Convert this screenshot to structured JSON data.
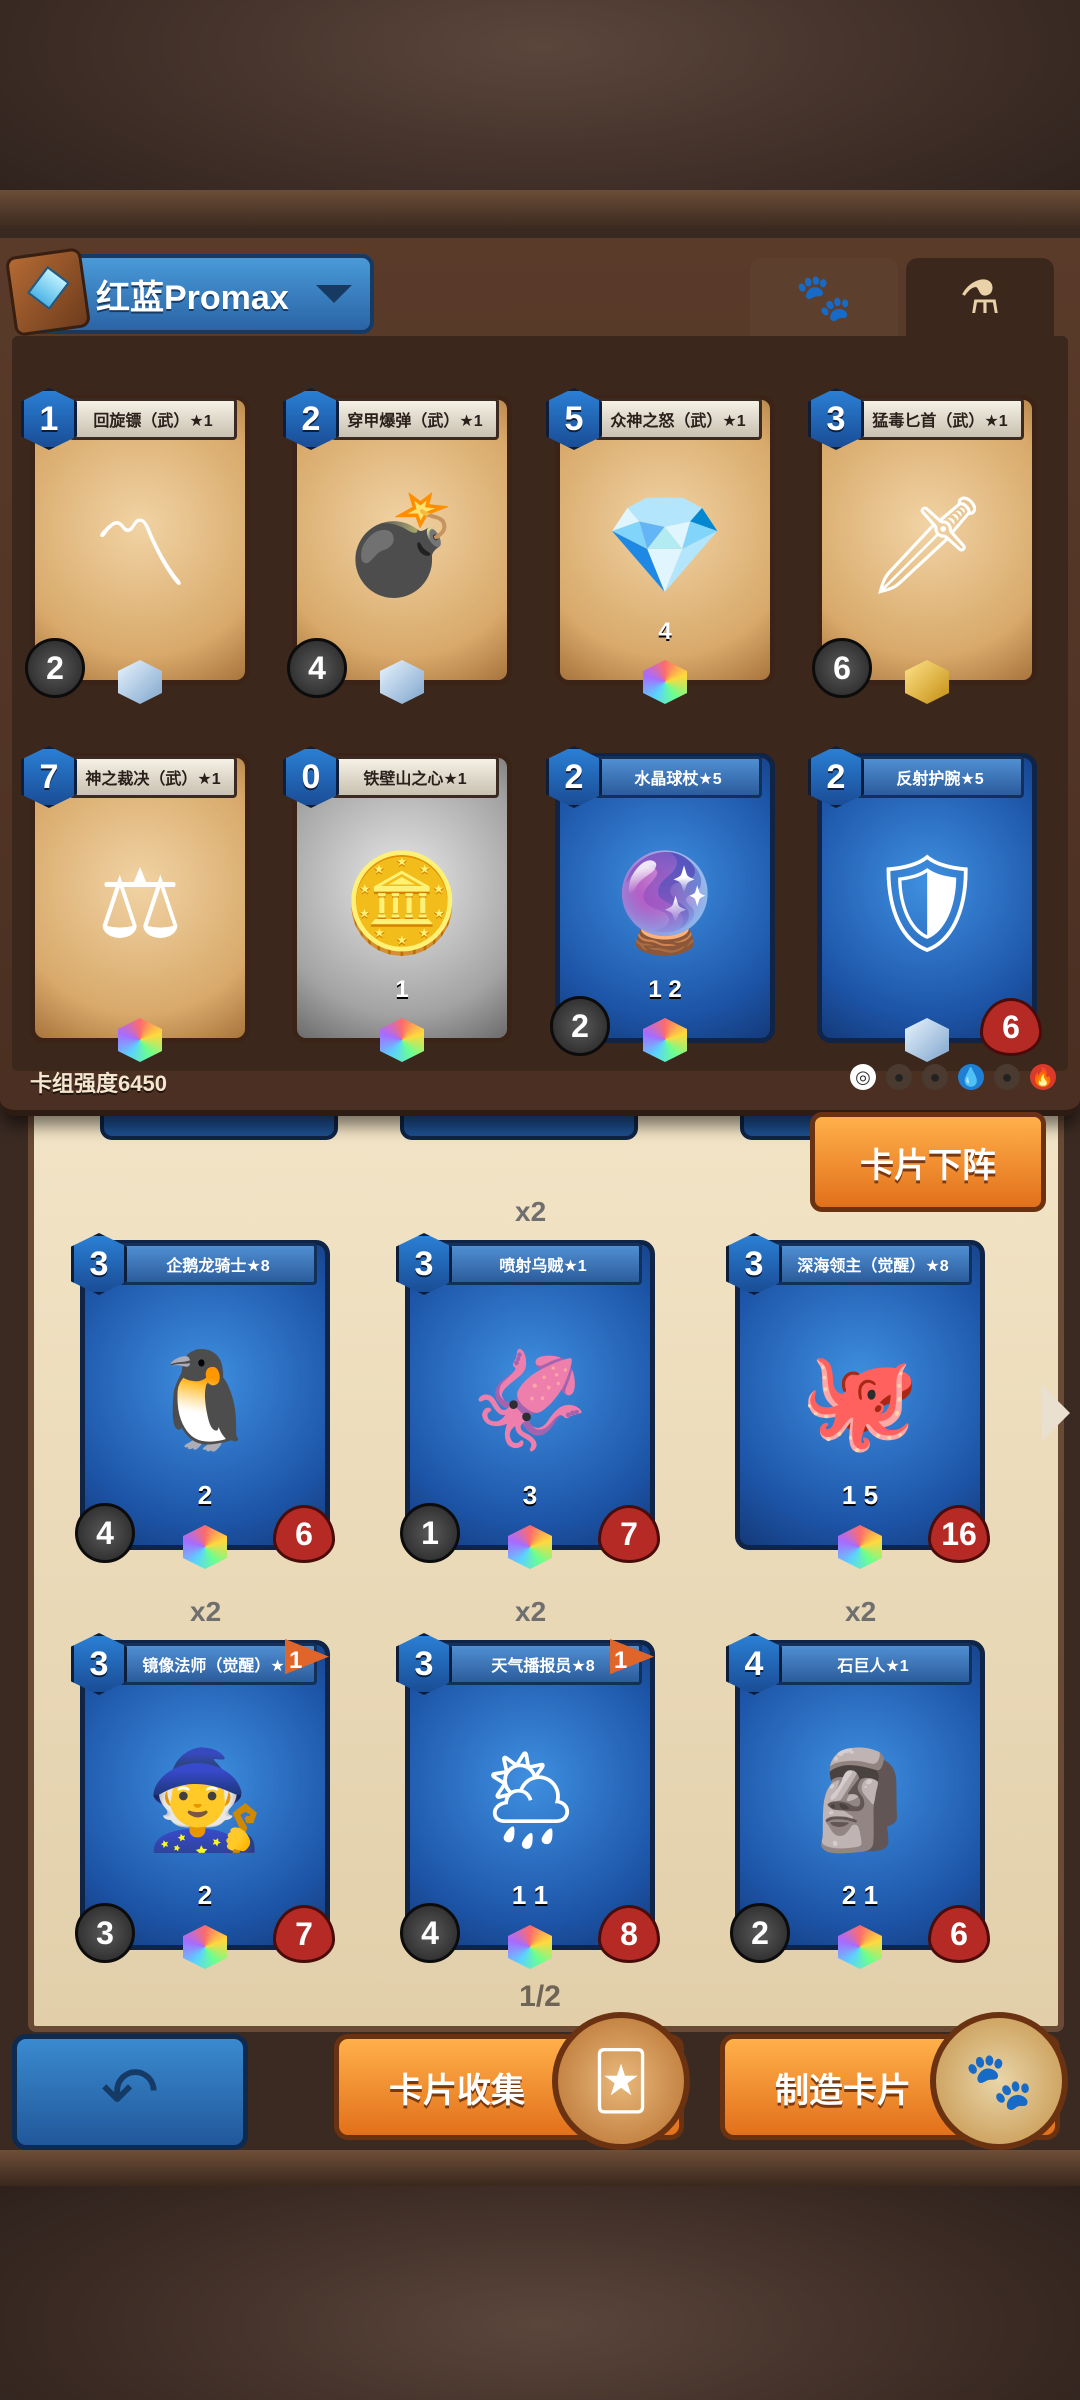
{
  "deck": {
    "name": "红蓝Promax",
    "power_label": "卡组强度6450",
    "cards": [
      {
        "name": "回旋镖（武）★1",
        "cost": "1",
        "atk": "2",
        "hp": "",
        "style": "tan",
        "icon": "boomerang-icon",
        "art": "〽",
        "gem": "ice",
        "badge": ""
      },
      {
        "name": "穿甲爆弹（武）★1",
        "cost": "2",
        "atk": "4",
        "hp": "",
        "style": "tan",
        "icon": "bomb-icon",
        "art": "💣",
        "gem": "ice",
        "badge": ""
      },
      {
        "name": "众神之怒（武）★1",
        "cost": "5",
        "atk": "",
        "hp": "",
        "style": "tan",
        "icon": "crystal-icon",
        "art": "💎",
        "gem": "rainbow",
        "badge": "4"
      },
      {
        "name": "猛毒匕首（武）★1",
        "cost": "3",
        "atk": "6",
        "hp": "",
        "style": "tan",
        "icon": "dagger-icon",
        "art": "🗡",
        "gem": "gold",
        "badge": ""
      },
      {
        "name": "神之裁决（武）★1",
        "cost": "7",
        "atk": "",
        "hp": "",
        "style": "tan",
        "icon": "scales-icon",
        "art": "⚖",
        "gem": "rainbow",
        "badge": ""
      },
      {
        "name": "铁壁山之心★1",
        "cost": "0",
        "atk": "",
        "hp": "",
        "style": "gray",
        "icon": "medallion-icon",
        "art": "🪙",
        "gem": "rainbow",
        "badge": "1"
      },
      {
        "name": "水晶球杖★5",
        "cost": "2",
        "atk": "2",
        "hp": "",
        "style": "blue",
        "icon": "crystal-staff-icon",
        "art": "🔮",
        "gem": "rainbow",
        "badge": "1 2"
      },
      {
        "name": "反射护腕★5",
        "cost": "2",
        "atk": "",
        "hp": "6",
        "style": "blue",
        "icon": "bracers-icon",
        "art": "🛡",
        "gem": "ice",
        "badge": ""
      }
    ]
  },
  "remove_button_label": "卡片下阵",
  "collection": {
    "cards": [
      {
        "name": "企鹅龙骑士★8",
        "cost": "3",
        "atk": "4",
        "hp": "6",
        "count": "",
        "flag": "",
        "icon": "penguin-knight-icon",
        "art": "🐧",
        "badge": "2"
      },
      {
        "name": "喷射乌贼★1",
        "cost": "3",
        "atk": "1",
        "hp": "7",
        "count": "x2",
        "flag": "",
        "icon": "squid-icon",
        "art": "🦑",
        "badge": "3"
      },
      {
        "name": "深海领主（觉醒）★8",
        "cost": "3",
        "atk": "",
        "hp": "16",
        "count": "",
        "flag": "",
        "icon": "deep-sea-lord-icon",
        "art": "🐙",
        "badge": "1 5"
      },
      {
        "name": "镜像法师（觉醒）★8",
        "cost": "3",
        "atk": "3",
        "hp": "7",
        "count": "x2",
        "flag": "1",
        "icon": "mirror-mage-icon",
        "art": "🧙",
        "badge": "2"
      },
      {
        "name": "天气播报员★8",
        "cost": "3",
        "atk": "4",
        "hp": "8",
        "count": "x2",
        "flag": "1",
        "icon": "weather-reporter-icon",
        "art": "🌦",
        "badge": "1 1"
      },
      {
        "name": "石巨人★1",
        "cost": "4",
        "atk": "2",
        "hp": "6",
        "count": "x2",
        "flag": "",
        "icon": "stone-golem-icon",
        "art": "🗿",
        "badge": "2 1"
      }
    ],
    "page": "1/2"
  },
  "buttons": {
    "collect": "卡片收集",
    "craft": "制造卡片"
  },
  "colors": {
    "orange": "#e2701b",
    "blue": "#2a64a6",
    "panel": "#4a2f22"
  }
}
